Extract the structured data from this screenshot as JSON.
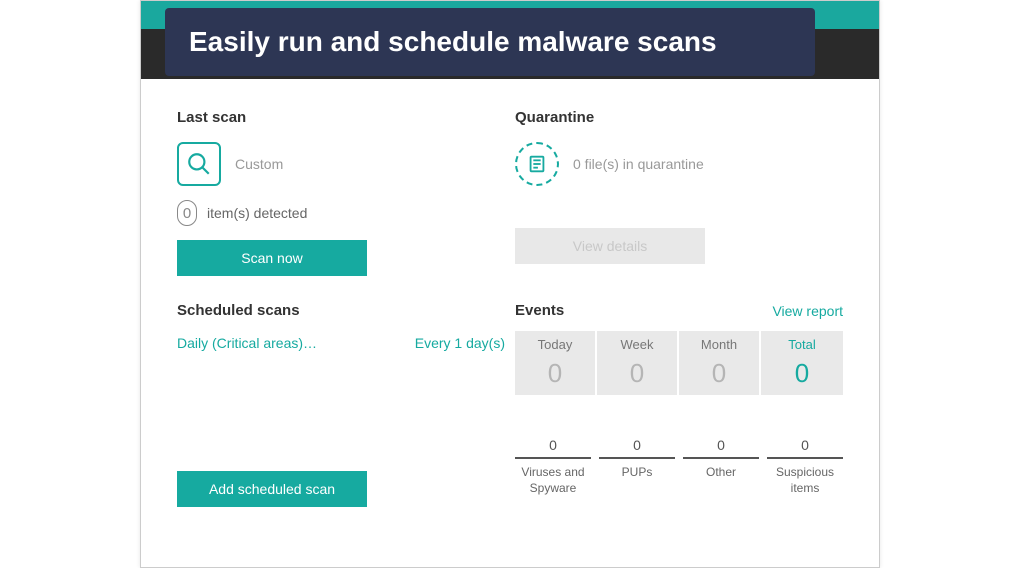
{
  "banner": "Easily run and schedule malware scans",
  "last_scan": {
    "title": "Last scan",
    "type": "Custom",
    "detected_count": "0",
    "detected_label": "item(s) detected",
    "scan_button": "Scan now"
  },
  "quarantine": {
    "title": "Quarantine",
    "status": "0 file(s) in quarantine",
    "view_button": "View details"
  },
  "scheduled": {
    "title": "Scheduled scans",
    "item_name": "Daily (Critical areas)…",
    "item_freq": "Every 1 day(s)",
    "add_button": "Add scheduled scan"
  },
  "events": {
    "title": "Events",
    "view_report": "View report",
    "tabs": [
      {
        "label": "Today",
        "value": "0",
        "highlight": false
      },
      {
        "label": "Week",
        "value": "0",
        "highlight": false
      },
      {
        "label": "Month",
        "value": "0",
        "highlight": false
      },
      {
        "label": "Total",
        "value": "0",
        "highlight": true
      }
    ],
    "categories": [
      {
        "count": "0",
        "label": "Viruses and Spyware"
      },
      {
        "count": "0",
        "label": "PUPs"
      },
      {
        "count": "0",
        "label": "Other"
      },
      {
        "count": "0",
        "label": "Suspicious items"
      }
    ]
  }
}
